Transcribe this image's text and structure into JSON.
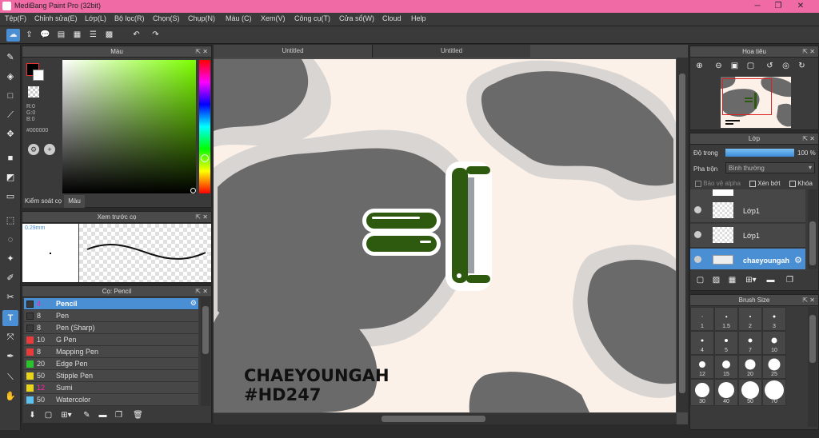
{
  "app": {
    "title": "MediBang Paint Pro (32bit)"
  },
  "menu": [
    "Tệp(F)",
    "Chỉnh sửa(E)",
    "Lớp(L)",
    "Bộ lọc(R)",
    "Chọn(S)",
    "Chụp(N)",
    "Màu (C)",
    "Xem(V)",
    "Công cụ(T)",
    "Cửa sổ(W)",
    "Cloud",
    "Help"
  ],
  "color_panel": {
    "title": "Màu",
    "r": "R:0",
    "g": "G:0",
    "b": "B:0",
    "hex": "#000000",
    "tab1": "Kiểm soát cọ",
    "tab2": "Màu"
  },
  "brush_preview": {
    "title": "Xem trước cọ",
    "size": "0.29mm"
  },
  "brush_panel": {
    "title": "Cọ: Pencil",
    "items": [
      {
        "size": "4",
        "name": "Pencil",
        "color": "#3a3a3a",
        "selected": true
      },
      {
        "size": "8",
        "name": "Pen",
        "color": "#3a3a3a"
      },
      {
        "size": "8",
        "name": "Pen (Sharp)",
        "color": "#3a3a3a"
      },
      {
        "size": "10",
        "name": "G Pen",
        "color": "#e83c3c"
      },
      {
        "size": "8",
        "name": "Mapping Pen",
        "color": "#e83c3c"
      },
      {
        "size": "20",
        "name": "Edge Pen",
        "color": "#2cc42c"
      },
      {
        "size": "50",
        "name": "Stipple Pen",
        "color": "#e8d41a"
      },
      {
        "size": "12",
        "name": "Sumi",
        "color": "#e8d41a"
      },
      {
        "size": "50",
        "name": "Watercolor",
        "color": "#5ec2f0"
      }
    ]
  },
  "tabs": [
    "Untitled",
    "Untitled"
  ],
  "canvas": {
    "text_line1": "CHAEYOUNGAH",
    "text_line2": "#HD247"
  },
  "navigator": {
    "title": "Hoa tiêu"
  },
  "layer_panel": {
    "title": "Lớp",
    "opacity_label": "Độ trong",
    "opacity_value": "100 %",
    "opacity_fraction": 1.0,
    "blend_label": "Pha trộn",
    "blend_value": "Bình thường",
    "protect_alpha": "Bảo vệ alpha",
    "clip": "Xén bớt",
    "lock": "Khóa",
    "layers": [
      {
        "name": "Lớp1",
        "selected": false
      },
      {
        "name": "Lớp1",
        "selected": false
      },
      {
        "name": "chaeyoungah",
        "selected": true
      }
    ]
  },
  "brush_size": {
    "title": "Brush Size",
    "sizes": [
      "1",
      "1.5",
      "2",
      "3",
      "4",
      "5",
      "7",
      "10",
      "12",
      "15",
      "20",
      "25",
      "30",
      "40",
      "50",
      "70"
    ]
  }
}
